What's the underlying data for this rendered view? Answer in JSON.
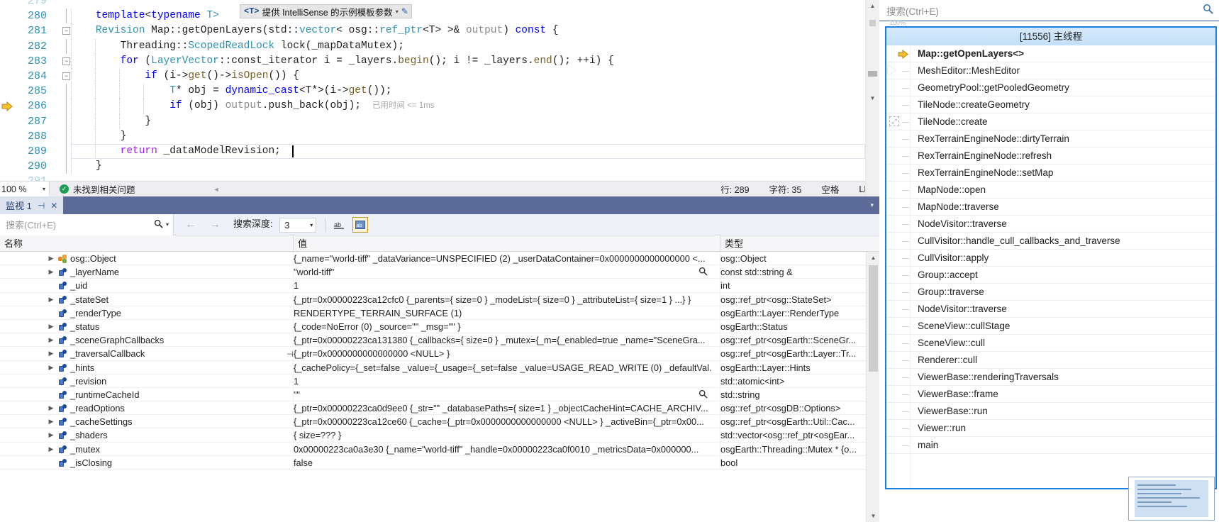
{
  "editor": {
    "lines": [
      {
        "num": "279",
        "partial": true,
        "fold": "",
        "text": ""
      },
      {
        "num": "280",
        "fold": "",
        "tokens": [
          {
            "t": "template",
            "c": "kw"
          },
          {
            "t": "<",
            "c": "plain"
          },
          {
            "t": "typename",
            "c": "kw"
          },
          {
            "t": " T>",
            "c": "type"
          }
        ],
        "indent": 1
      },
      {
        "num": "281",
        "fold": "-",
        "tokens": [
          {
            "t": "Revision",
            "c": "type"
          },
          {
            "t": " Map",
            "c": "plain"
          },
          {
            "t": "::",
            "c": "plain"
          },
          {
            "t": "getOpenLayers",
            "c": "plain"
          },
          {
            "t": "(std::",
            "c": "plain"
          },
          {
            "t": "vector",
            "c": "type"
          },
          {
            "t": "< osg::",
            "c": "plain"
          },
          {
            "t": "ref_ptr",
            "c": "type"
          },
          {
            "t": "<T> >& ",
            "c": "plain"
          },
          {
            "t": "output",
            "c": "param"
          },
          {
            "t": ") ",
            "c": "plain"
          },
          {
            "t": "const",
            "c": "kw"
          },
          {
            "t": " {",
            "c": "plain"
          }
        ],
        "indent": 1
      },
      {
        "num": "282",
        "fold": "",
        "tokens": [
          {
            "t": "Threading",
            "c": "plain"
          },
          {
            "t": "::",
            "c": "plain"
          },
          {
            "t": "ScopedReadLock",
            "c": "type"
          },
          {
            "t": " lock(_mapDataMutex);",
            "c": "plain"
          }
        ],
        "indent": 2
      },
      {
        "num": "283",
        "fold": "-",
        "tokens": [
          {
            "t": "for",
            "c": "kw"
          },
          {
            "t": " (",
            "c": "plain"
          },
          {
            "t": "LayerVector",
            "c": "type"
          },
          {
            "t": "::const_iterator i = _layers.",
            "c": "plain"
          },
          {
            "t": "begin",
            "c": "fn"
          },
          {
            "t": "(); i != _layers.",
            "c": "plain"
          },
          {
            "t": "end",
            "c": "fn"
          },
          {
            "t": "(); ++i) {",
            "c": "plain"
          }
        ],
        "indent": 2
      },
      {
        "num": "284",
        "fold": "-",
        "tokens": [
          {
            "t": "if",
            "c": "kw"
          },
          {
            "t": " (i->",
            "c": "plain"
          },
          {
            "t": "get",
            "c": "fn"
          },
          {
            "t": "()->",
            "c": "plain"
          },
          {
            "t": "isOpen",
            "c": "fn"
          },
          {
            "t": "()) {",
            "c": "plain"
          }
        ],
        "indent": 3
      },
      {
        "num": "285",
        "fold": "",
        "tokens": [
          {
            "t": "T",
            "c": "type"
          },
          {
            "t": "* obj = ",
            "c": "plain"
          },
          {
            "t": "dynamic_cast",
            "c": "kw"
          },
          {
            "t": "<T*>(i->",
            "c": "plain"
          },
          {
            "t": "get",
            "c": "fn"
          },
          {
            "t": "());",
            "c": "plain"
          }
        ],
        "indent": 4
      },
      {
        "num": "286",
        "fold": "",
        "current": true,
        "tokens": [
          {
            "t": "if",
            "c": "kw"
          },
          {
            "t": " (obj) ",
            "c": "plain"
          },
          {
            "t": "output",
            "c": "param"
          },
          {
            "t": ".",
            "c": "plain"
          },
          {
            "t": "push_back",
            "c": "plain"
          },
          {
            "t": "(obj);",
            "c": "plain"
          }
        ],
        "elapsed": "已用时间 <= 1ms",
        "indent": 4
      },
      {
        "num": "287",
        "fold": "",
        "tokens": [
          {
            "t": "}",
            "c": "plain"
          }
        ],
        "indent": 3
      },
      {
        "num": "288",
        "fold": "",
        "tokens": [
          {
            "t": "}",
            "c": "plain"
          }
        ],
        "indent": 2
      },
      {
        "num": "289",
        "fold": "",
        "caretline": true,
        "tokens": [
          {
            "t": "return",
            "c": "kw2"
          },
          {
            "t": " _dataModelRevision;",
            "c": "plain"
          }
        ],
        "indent": 2
      },
      {
        "num": "290",
        "fold": "",
        "tokens": [
          {
            "t": "}",
            "c": "plain"
          }
        ],
        "indent": 1
      },
      {
        "num": "291",
        "partial": true,
        "fold": "",
        "text": ""
      }
    ],
    "intellisense_chip": {
      "tparam": "<T>",
      "text": "提供 IntelliSense 的示例模板参数",
      "caret": "▾",
      "pencil": "✎"
    }
  },
  "editor_status": {
    "zoom": "100 %",
    "zoom_caret": "▾",
    "problems": "未找到相关问题",
    "ok_glyph": "✓",
    "collapse_arrow": "◄",
    "line_label": "行: 289",
    "col_label": "字符: 35",
    "space_label": "空格",
    "eol_label": "LF"
  },
  "watch": {
    "tab_title": "监视 1",
    "pin_glyph": "⊣",
    "close_glyph": "✕",
    "tabstrip_caret": "▾",
    "search_placeholder": "搜索(Ctrl+E)",
    "search_mag": "🔍",
    "search_caret": "▾",
    "nav_back": "←",
    "nav_forward": "→",
    "depth_label": "搜索深度:",
    "depth_value": "3",
    "depth_caret": "▾",
    "columns": {
      "name": "名称",
      "value": "值",
      "type": "类型"
    },
    "rows": [
      {
        "expander": "▶",
        "icon": "namespace",
        "name": "osg::Object",
        "value": "{_name=\"world-tiff\" _dataVariance=UNSPECIFIED (2) _userDataContainer=0x0000000000000000 <...",
        "type": "osg::Object",
        "mag": false,
        "pin": false
      },
      {
        "expander": "▶",
        "icon": "field",
        "name": "_layerName",
        "value": "\"world-tiff\"",
        "type": "const std::string &",
        "mag": true,
        "pin": false
      },
      {
        "expander": "",
        "icon": "field",
        "name": "_uid",
        "value": "1",
        "type": "int",
        "mag": false,
        "pin": false
      },
      {
        "expander": "▶",
        "icon": "field",
        "name": "_stateSet",
        "value": "{_ptr=0x00000223ca12cfc0 {_parents={ size=0 } _modeList={ size=0 } _attributeList={ size=1 } ...} }",
        "type": "osg::ref_ptr<osg::StateSet>",
        "mag": false,
        "pin": false
      },
      {
        "expander": "",
        "icon": "field",
        "name": "_renderType",
        "value": "RENDERTYPE_TERRAIN_SURFACE (1)",
        "type": "osgEarth::Layer::RenderType",
        "mag": false,
        "pin": false
      },
      {
        "expander": "▶",
        "icon": "field",
        "name": "_status",
        "value": "{_code=NoError (0) _source=\"\" _msg=\"\" }",
        "type": "osgEarth::Status",
        "mag": false,
        "pin": false
      },
      {
        "expander": "▶",
        "icon": "field",
        "name": "_sceneGraphCallbacks",
        "value": "{_ptr=0x00000223ca131380 {_callbacks={ size=0 } _mutex={_m={_enabled=true _name=\"SceneGra...",
        "type": "osg::ref_ptr<osgEarth::SceneGr...",
        "mag": false,
        "pin": false
      },
      {
        "expander": "▶",
        "icon": "field",
        "name": "_traversalCallback",
        "value": "{_ptr=0x0000000000000000 <NULL> }",
        "type": "osg::ref_ptr<osgEarth::Layer::Tr...",
        "mag": false,
        "pin": true
      },
      {
        "expander": "▶",
        "icon": "field",
        "name": "_hints",
        "value": "{_cachePolicy={_set=false _value={_usage={_set=false _value=USAGE_READ_WRITE (0) _defaultVal...",
        "type": "osgEarth::Layer::Hints",
        "mag": false,
        "pin": false
      },
      {
        "expander": "",
        "icon": "field",
        "name": "_revision",
        "value": "1",
        "type": "std::atomic<int>",
        "mag": false,
        "pin": false
      },
      {
        "expander": "",
        "icon": "field",
        "name": "_runtimeCacheId",
        "value": "\"\"",
        "type": "std::string",
        "mag": true,
        "pin": false
      },
      {
        "expander": "▶",
        "icon": "field",
        "name": "_readOptions",
        "value": "{_ptr=0x00000223ca0d9ee0 {_str=\"\" _databasePaths={ size=1 } _objectCacheHint=CACHE_ARCHIV...",
        "type": "osg::ref_ptr<osgDB::Options>",
        "mag": false,
        "pin": false
      },
      {
        "expander": "▶",
        "icon": "field",
        "name": "_cacheSettings",
        "value": "{_ptr=0x00000223ca12ce60 {_cache={_ptr=0x0000000000000000 <NULL> } _activeBin={_ptr=0x00...",
        "type": "osg::ref_ptr<osgEarth::Util::Cac...",
        "mag": false,
        "pin": false
      },
      {
        "expander": "▶",
        "icon": "field",
        "name": "_shaders",
        "value": "{ size=??? }",
        "type": "std::vector<osg::ref_ptr<osgEar...",
        "mag": false,
        "pin": false
      },
      {
        "expander": "▶",
        "icon": "field",
        "name": "_mutex",
        "value": "0x00000223ca0a3e30 {_name=\"world-tiff\" _handle=0x00000223ca0f0010 _metricsData=0x000000...",
        "type": "osgEarth::Threading::Mutex * {o...",
        "mag": false,
        "pin": false
      },
      {
        "expander": "",
        "icon": "field",
        "name": "_isClosing",
        "value": "false",
        "type": "bool",
        "mag": false,
        "pin": false
      }
    ]
  },
  "callstack": {
    "search_placeholder": "搜索(Ctrl+E)",
    "search_icon": "🔍",
    "thread_header": "[11556] 主线程",
    "frames": [
      {
        "label": "Map::getOpenLayers<>",
        "active": true
      },
      {
        "label": "MeshEditor::MeshEditor",
        "active": false
      },
      {
        "label": "GeometryPool::getPooledGeometry",
        "active": false
      },
      {
        "label": "TileNode::createGeometry",
        "active": false
      },
      {
        "label": "TileNode::create",
        "active": false
      },
      {
        "label": "RexTerrainEngineNode::dirtyTerrain",
        "active": false
      },
      {
        "label": "RexTerrainEngineNode::refresh",
        "active": false
      },
      {
        "label": "RexTerrainEngineNode::setMap",
        "active": false
      },
      {
        "label": "MapNode::open",
        "active": false
      },
      {
        "label": "MapNode::traverse",
        "active": false
      },
      {
        "label": "NodeVisitor::traverse",
        "active": false
      },
      {
        "label": "CullVisitor::handle_cull_callbacks_and_traverse",
        "active": false
      },
      {
        "label": "CullVisitor::apply",
        "active": false
      },
      {
        "label": "Group::accept",
        "active": false
      },
      {
        "label": "Group::traverse",
        "active": false
      },
      {
        "label": "NodeVisitor::traverse",
        "active": false
      },
      {
        "label": "SceneView::cullStage",
        "active": false
      },
      {
        "label": "SceneView::cull",
        "active": false
      },
      {
        "label": "Renderer::cull",
        "active": false
      },
      {
        "label": "ViewerBase::renderingTraversals",
        "active": false
      },
      {
        "label": "ViewerBase::frame",
        "active": false
      },
      {
        "label": "ViewerBase::run",
        "active": false
      },
      {
        "label": "Viewer::run",
        "active": false
      },
      {
        "label": "main",
        "active": false
      }
    ],
    "percent_marker": "100%"
  },
  "colors": {
    "accent_blue": "#1a7fe0",
    "tabstrip": "#5b6a96",
    "keyword": "#0000ff",
    "type": "#2b91af",
    "linenum": "#2b91af",
    "ok_green": "#1f9d55",
    "arrow_yellow": "#e0a91b"
  }
}
